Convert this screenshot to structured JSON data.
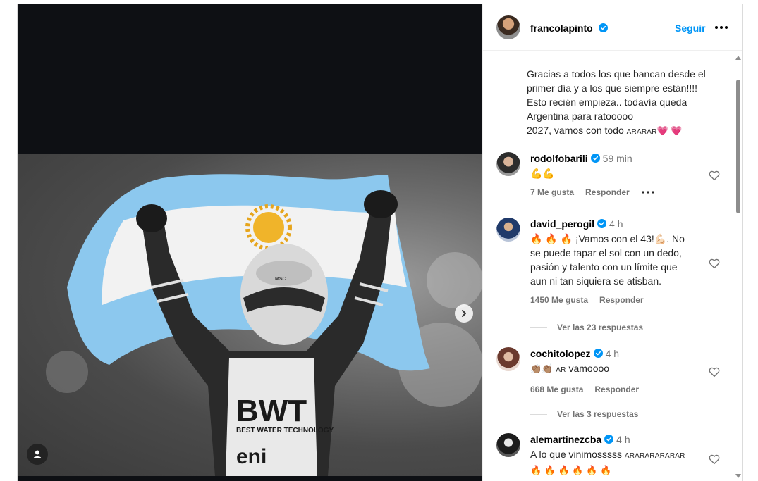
{
  "post": {
    "author": "francolapinto",
    "follow_label": "Seguir",
    "caption_lines": [
      "Gracias a todos los que bancan desde el",
      "primer día y a los que siempre están!!!!",
      "Esto recién empieza.. todavía queda",
      "Argentina para ratooooo"
    ],
    "caption_last": "2027, vamos con todo",
    "caption_flags": "ARARAR",
    "caption_hearts": "💗 💗"
  },
  "comments": [
    {
      "user": "rodolfobarili",
      "time": "59 min",
      "text": "💪💪",
      "likes": "7 Me gusta",
      "reply": "Responder"
    },
    {
      "user": "david_perogil",
      "time": "4 h",
      "text_prefix": "🔥 🔥 🔥 ¡Vamos con el 43!💪🏻. No",
      "text_lines": [
        "se puede tapar el sol con un dedo,",
        "pasión y talento con un límite que",
        "aun ni tan siquiera se atisban."
      ],
      "likes": "1450 Me gusta",
      "reply": "Responder",
      "replies": "Ver las 23 respuestas"
    },
    {
      "user": "cochitolopez",
      "time": "4 h",
      "text_flags": "AR",
      "text_main": "vamoooo",
      "likes": "668 Me gusta",
      "reply": "Responder",
      "replies": "Ver las 3 respuestas"
    },
    {
      "user": "alemartinezcba",
      "time": "4 h",
      "text_main": "A lo que vinimosssss",
      "text_flags": "ARARARARARAR",
      "text_fire": "🔥 🔥 🔥 🔥 🔥 🔥"
    }
  ],
  "photo_text": {
    "sponsor_main": "BWT",
    "sponsor_sub": "BEST WATER TECHNOLOGY",
    "sponsor_eni": "eni",
    "helmet_brand": "MSC"
  },
  "colors": {
    "accent": "#0095f6",
    "verified": "#0095f6",
    "muted": "#737373",
    "flag_blue": "#8cc8ee"
  }
}
